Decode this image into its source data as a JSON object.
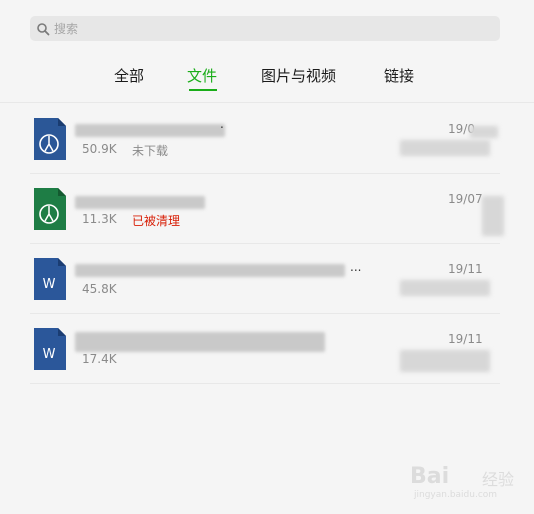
{
  "search": {
    "placeholder": "搜索",
    "icon": "search-icon"
  },
  "tabs": [
    {
      "label": "全部",
      "active": false
    },
    {
      "label": "文件",
      "active": true
    },
    {
      "label": "图片与视频",
      "active": false
    },
    {
      "label": "链接",
      "active": false
    }
  ],
  "accent_color": "#1aad19",
  "files": [
    {
      "type": "blue-app-file",
      "icon": "app-file-icon",
      "name_suffix": ".",
      "size": "50.9K",
      "status": "未下载",
      "date": "19/0"
    },
    {
      "type": "green-app-file",
      "icon": "app-file-icon",
      "name_suffix": "",
      "size": "11.3K",
      "status": "已被清理",
      "date": "19/07"
    },
    {
      "type": "word-document",
      "icon": "word-icon",
      "name_suffix": "...",
      "size": "45.8K",
      "status": "",
      "date": "19/11"
    },
    {
      "type": "word-document",
      "icon": "word-icon",
      "name_suffix": "",
      "size": "17.4K",
      "status": "",
      "date": "19/11"
    }
  ],
  "watermark": {
    "text": "Bai",
    "cn": "经验",
    "sub": "jingyan.baidu.com"
  }
}
